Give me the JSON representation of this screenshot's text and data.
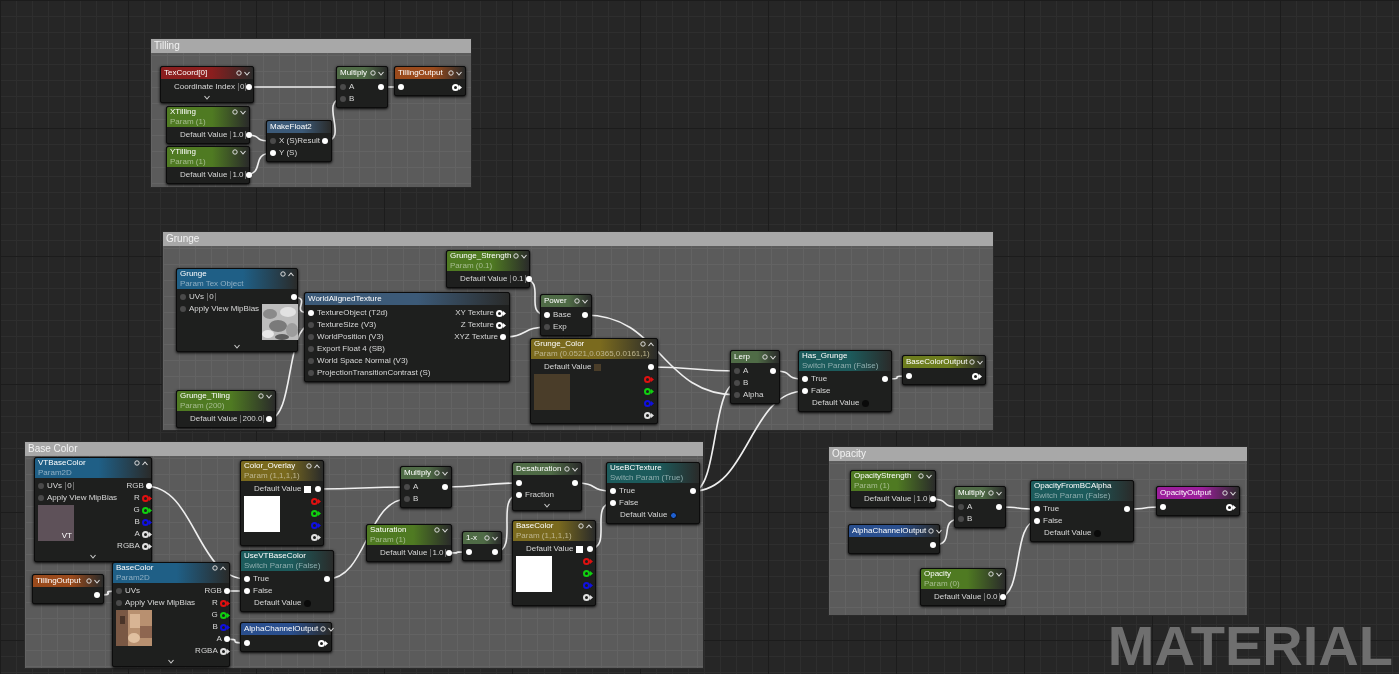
{
  "comments": [
    {
      "title": "Tilling",
      "nodes": [
        {
          "title": "TexCoord[0]",
          "color": "#8b1e1e",
          "expanded": false,
          "more_pins": true,
          "inputs": [
            {
              "label": "Coordinate Index",
              "value": "0"
            }
          ],
          "outputs": [
            {
              "pin_filled": true
            }
          ]
        },
        {
          "title": "XTilling",
          "subtitle": "Param (1)",
          "color": "#4f7a22",
          "expanded": false,
          "inputs": [
            {
              "label": "Default Value",
              "value": "1.0"
            }
          ],
          "outputs": [
            {
              "pin_filled": true
            }
          ]
        },
        {
          "title": "YTilling",
          "subtitle": "Param (1)",
          "color": "#4f7a22",
          "expanded": false,
          "inputs": [
            {
              "label": "Default Value",
              "value": "1.0"
            }
          ],
          "outputs": [
            {
              "pin_filled": true
            }
          ]
        },
        {
          "title": "MakeFloat2",
          "color": "#3c5a78",
          "inputs": [
            {
              "label": "X (S)",
              "pin_filled": false
            },
            {
              "label": "Y (S)",
              "pin_filled": true
            }
          ],
          "outputs": [
            {
              "label": "Result",
              "pin_filled": true
            }
          ]
        },
        {
          "title": "Multiply",
          "color": "#4f6b46",
          "expanded": false,
          "inputs": [
            {
              "label": "A",
              "pin_filled": false
            },
            {
              "label": "B",
              "pin_filled": false
            }
          ],
          "outputs": [
            {
              "pin_filled": true
            }
          ]
        },
        {
          "title": "TillingOutput",
          "color": "#9a4a1c",
          "expanded": false,
          "inputs": [
            {
              "pin_filled": true
            }
          ],
          "outputs": [
            {
              "pin_filled": false
            }
          ]
        }
      ]
    },
    {
      "title": "Grunge",
      "nodes": [
        {
          "title": "Grunge",
          "subtitle": "Param Tex Object",
          "color": "#1f5f86",
          "expanded": true,
          "more_pins": true,
          "preview": {
            "kind": "picture"
          },
          "inputs": [
            {
              "label": "UVs",
              "pin_filled": false,
              "value": "0"
            },
            {
              "label": "Apply View MipBias",
              "pin_filled": false
            }
          ],
          "outputs": [
            {
              "pin_filled": true
            }
          ]
        },
        {
          "title": "WorldAlignedTexture",
          "color": "#3c5a78",
          "inputs": [
            {
              "label": "TextureObject (T2d)",
              "pin_filled": true
            },
            {
              "label": "TextureSize (V3)",
              "pin_filled": false
            },
            {
              "label": "WorldPosition (V3)",
              "pin_filled": false
            },
            {
              "label": "Export Float 4 (SB)",
              "pin_filled": false
            },
            {
              "label": "World Space Normal (V3)",
              "pin_filled": false
            },
            {
              "label": "ProjectionTransitionContrast (S)",
              "pin_filled": false
            }
          ],
          "outputs": [
            {
              "label": "XY Texture",
              "pin_filled": false
            },
            {
              "label": "Z Texture",
              "pin_filled": false
            },
            {
              "label": "XYZ Texture",
              "pin_filled": true
            }
          ]
        },
        {
          "title": "Grunge_Strength",
          "subtitle": "Param (0.1)",
          "color": "#4f7a22",
          "expanded": false,
          "inputs": [
            {
              "label": "Default Value",
              "value": "0.1"
            }
          ],
          "outputs": [
            {
              "pin_filled": true
            }
          ]
        },
        {
          "title": "Power",
          "color": "#4f6b46",
          "expanded": false,
          "inputs": [
            {
              "label": "Base",
              "pin_filled": true
            },
            {
              "label": "Exp",
              "pin_filled": false
            }
          ],
          "outputs": [
            {
              "pin_filled": true
            }
          ]
        },
        {
          "title": "Grunge_Color",
          "subtitle": "Param (0.0521,0.0365,0.0161,1)",
          "color": "#7a6a1e",
          "expanded": true,
          "preview": {
            "kind": "swatch",
            "color": "#4a3d29"
          },
          "inputs": [
            {
              "label": "Default Value",
              "color": "#4a3d29"
            }
          ],
          "outputs": [
            {
              "pin_filled": true
            },
            {
              "pin_filled": false,
              "color": "#e01010"
            },
            {
              "pin_filled": false,
              "color": "#10d010"
            },
            {
              "pin_filled": false,
              "color": "#1010e0"
            },
            {
              "pin_filled": false,
              "color": "#e0e0e0"
            }
          ]
        },
        {
          "title": "Grunge_Tiling",
          "subtitle": "Param (200)",
          "color": "#4f7a22",
          "expanded": false,
          "inputs": [
            {
              "label": "Default Value",
              "value": "200.0"
            }
          ],
          "outputs": [
            {
              "pin_filled": true
            }
          ]
        },
        {
          "title": "Lerp",
          "color": "#4f6b46",
          "expanded": false,
          "inputs": [
            {
              "label": "A",
              "pin_filled": false
            },
            {
              "label": "B",
              "pin_filled": false
            },
            {
              "label": "Alpha",
              "pin_filled": false
            }
          ],
          "outputs": [
            {
              "pin_filled": true
            }
          ]
        },
        {
          "title": "Has_Grunge",
          "subtitle": "Switch Param (False)",
          "color": "#1c5b5c",
          "inputs": [
            {
              "label": "True",
              "pin_filled": true
            },
            {
              "label": "False",
              "pin_filled": true
            },
            {
              "label": "Default Value",
              "checked": false
            }
          ],
          "outputs": [
            {
              "pin_filled": true
            }
          ]
        },
        {
          "title": "BaseColorOutput",
          "color": "#6d7d1e",
          "expanded": false,
          "inputs": [
            {
              "pin_filled": true
            }
          ],
          "outputs": [
            {
              "pin_filled": false
            }
          ]
        }
      ]
    },
    {
      "title": "Base Color",
      "nodes": [
        {
          "title": "VTBaseColor",
          "subtitle": "Param2D",
          "color": "#1f5f86",
          "expanded": true,
          "more_pins": true,
          "preview": {
            "kind": "swatch",
            "color": "#5e5159",
            "label": "VT"
          },
          "inputs": [
            {
              "label": "UVs",
              "pin_filled": false,
              "value": "0"
            },
            {
              "label": "Apply View MipBias",
              "pin_filled": false
            }
          ],
          "outputs": [
            {
              "label": "RGB",
              "pin_filled": true
            },
            {
              "label": "R",
              "pin_filled": false,
              "color": "#e01010"
            },
            {
              "label": "G",
              "pin_filled": false,
              "color": "#10d010"
            },
            {
              "label": "B",
              "pin_filled": false,
              "color": "#1010e0"
            },
            {
              "label": "A",
              "pin_filled": false,
              "color": "#e0e0e0"
            },
            {
              "label": "RGBA",
              "pin_filled": false,
              "color": "#e0e0e0"
            }
          ]
        },
        {
          "title": "Color_Overlay",
          "subtitle": "Param (1,1,1,1)",
          "color": "#7a6a1e",
          "expanded": true,
          "preview": {
            "kind": "swatch",
            "color": "#ffffff"
          },
          "inputs": [
            {
              "label": "Default Value",
              "color": "#ffffff"
            }
          ],
          "outputs": [
            {
              "pin_filled": true
            },
            {
              "pin_filled": false,
              "color": "#e01010"
            },
            {
              "pin_filled": false,
              "color": "#10d010"
            },
            {
              "pin_filled": false,
              "color": "#1010e0"
            },
            {
              "pin_filled": false,
              "color": "#e0e0e0"
            }
          ]
        },
        {
          "title": "TillingOutput",
          "color": "#9a4a1c",
          "expanded": false,
          "outputs": [
            {
              "pin_filled": true
            }
          ]
        },
        {
          "title": "BaseColor",
          "subtitle": "Param2D",
          "color": "#1f5f86",
          "expanded": true,
          "more_pins": true,
          "preview": {
            "kind": "picture"
          },
          "inputs": [
            {
              "label": "UVs",
              "pin_filled": false
            },
            {
              "label": "Apply View MipBias",
              "pin_filled": false
            }
          ],
          "outputs": [
            {
              "label": "RGB",
              "pin_filled": true
            },
            {
              "label": "R",
              "pin_filled": false,
              "color": "#e01010"
            },
            {
              "label": "G",
              "pin_filled": false,
              "color": "#10d010"
            },
            {
              "label": "B",
              "pin_filled": false,
              "color": "#1010e0"
            },
            {
              "label": "A",
              "pin_filled": true
            },
            {
              "label": "RGBA",
              "pin_filled": false,
              "color": "#e0e0e0"
            }
          ]
        },
        {
          "title": "UseVTBaseColor",
          "subtitle": "Switch Param (False)",
          "color": "#1c5b5c",
          "inputs": [
            {
              "label": "True",
              "pin_filled": true
            },
            {
              "label": "False",
              "pin_filled": true
            },
            {
              "label": "Default Value",
              "checked": false
            }
          ],
          "outputs": [
            {
              "pin_filled": true
            }
          ]
        },
        {
          "title": "AlphaChannelOutput",
          "color": "#2a4f8e",
          "expanded": false,
          "inputs": [
            {
              "pin_filled": true
            }
          ],
          "outputs": [
            {
              "pin_filled": false
            }
          ]
        },
        {
          "title": "Multiply",
          "color": "#4f6b46",
          "expanded": false,
          "inputs": [
            {
              "label": "A",
              "pin_filled": false
            },
            {
              "label": "B",
              "pin_filled": false
            }
          ],
          "outputs": [
            {
              "pin_filled": true
            }
          ]
        },
        {
          "title": "Saturation",
          "subtitle": "Param (1)",
          "color": "#4f7a22",
          "expanded": false,
          "inputs": [
            {
              "label": "Default Value",
              "value": "1.0"
            }
          ],
          "outputs": [
            {
              "pin_filled": true
            }
          ]
        },
        {
          "title": "1-x",
          "color": "#4f6b46",
          "expanded": false,
          "inputs": [
            {
              "pin_filled": true
            }
          ],
          "outputs": [
            {
              "pin_filled": true
            }
          ]
        },
        {
          "title": "Desaturation",
          "color": "#4f6b46",
          "expanded": false,
          "more_pins": true,
          "inputs": [
            {
              "pin_filled": true
            },
            {
              "label": "Fraction",
              "pin_filled": true
            }
          ],
          "outputs": [
            {
              "pin_filled": true
            }
          ]
        },
        {
          "title": "BaseColor",
          "subtitle": "Param (1,1,1,1)",
          "color": "#7a6a1e",
          "expanded": true,
          "preview": {
            "kind": "swatch",
            "color": "#ffffff"
          },
          "inputs": [
            {
              "label": "Default Value",
              "color": "#ffffff"
            }
          ],
          "outputs": [
            {
              "pin_filled": true
            },
            {
              "pin_filled": false,
              "color": "#e01010"
            },
            {
              "pin_filled": false,
              "color": "#10d010"
            },
            {
              "pin_filled": false,
              "color": "#1010e0"
            },
            {
              "pin_filled": false,
              "color": "#e0e0e0"
            }
          ]
        },
        {
          "title": "UseBCTexture",
          "subtitle": "Switch Param (True)",
          "color": "#1c5b5c",
          "inputs": [
            {
              "label": "True",
              "pin_filled": true
            },
            {
              "label": "False",
              "pin_filled": true
            },
            {
              "label": "Default Value",
              "checked": true
            }
          ],
          "outputs": [
            {
              "pin_filled": true
            }
          ]
        }
      ]
    },
    {
      "title": "Opacity",
      "nodes": [
        {
          "title": "OpacityStrength",
          "subtitle": "Param (1)",
          "color": "#4f7a22",
          "expanded": false,
          "inputs": [
            {
              "label": "Default Value",
              "value": "1.0"
            }
          ],
          "outputs": [
            {
              "pin_filled": true
            }
          ]
        },
        {
          "title": "Multiply",
          "color": "#4f6b46",
          "expanded": false,
          "inputs": [
            {
              "label": "A",
              "pin_filled": false
            },
            {
              "label": "B",
              "pin_filled": false
            }
          ],
          "outputs": [
            {
              "pin_filled": true
            }
          ]
        },
        {
          "title": "AlphaChannelOutput",
          "color": "#2a4f8e",
          "expanded": false,
          "outputs": [
            {
              "pin_filled": true
            }
          ]
        },
        {
          "title": "OpacityFromBCAlpha",
          "subtitle": "Switch Param (False)",
          "color": "#1c5b5c",
          "inputs": [
            {
              "label": "True",
              "pin_filled": true
            },
            {
              "label": "False",
              "pin_filled": true
            },
            {
              "label": "Default Value",
              "checked": false
            }
          ],
          "outputs": [
            {
              "pin_filled": true
            }
          ]
        },
        {
          "title": "Opacity",
          "subtitle": "Param (0)",
          "color": "#4f7a22",
          "expanded": false,
          "inputs": [
            {
              "label": "Default Value",
              "value": "0.0"
            }
          ],
          "outputs": [
            {
              "pin_filled": true
            }
          ]
        },
        {
          "title": "OpacityOutput",
          "color": "#9b1e9b",
          "expanded": false,
          "inputs": [
            {
              "pin_filled": true
            }
          ],
          "outputs": [
            {
              "pin_filled": false
            }
          ]
        }
      ]
    }
  ],
  "graph_type_label": "MATERIAL"
}
